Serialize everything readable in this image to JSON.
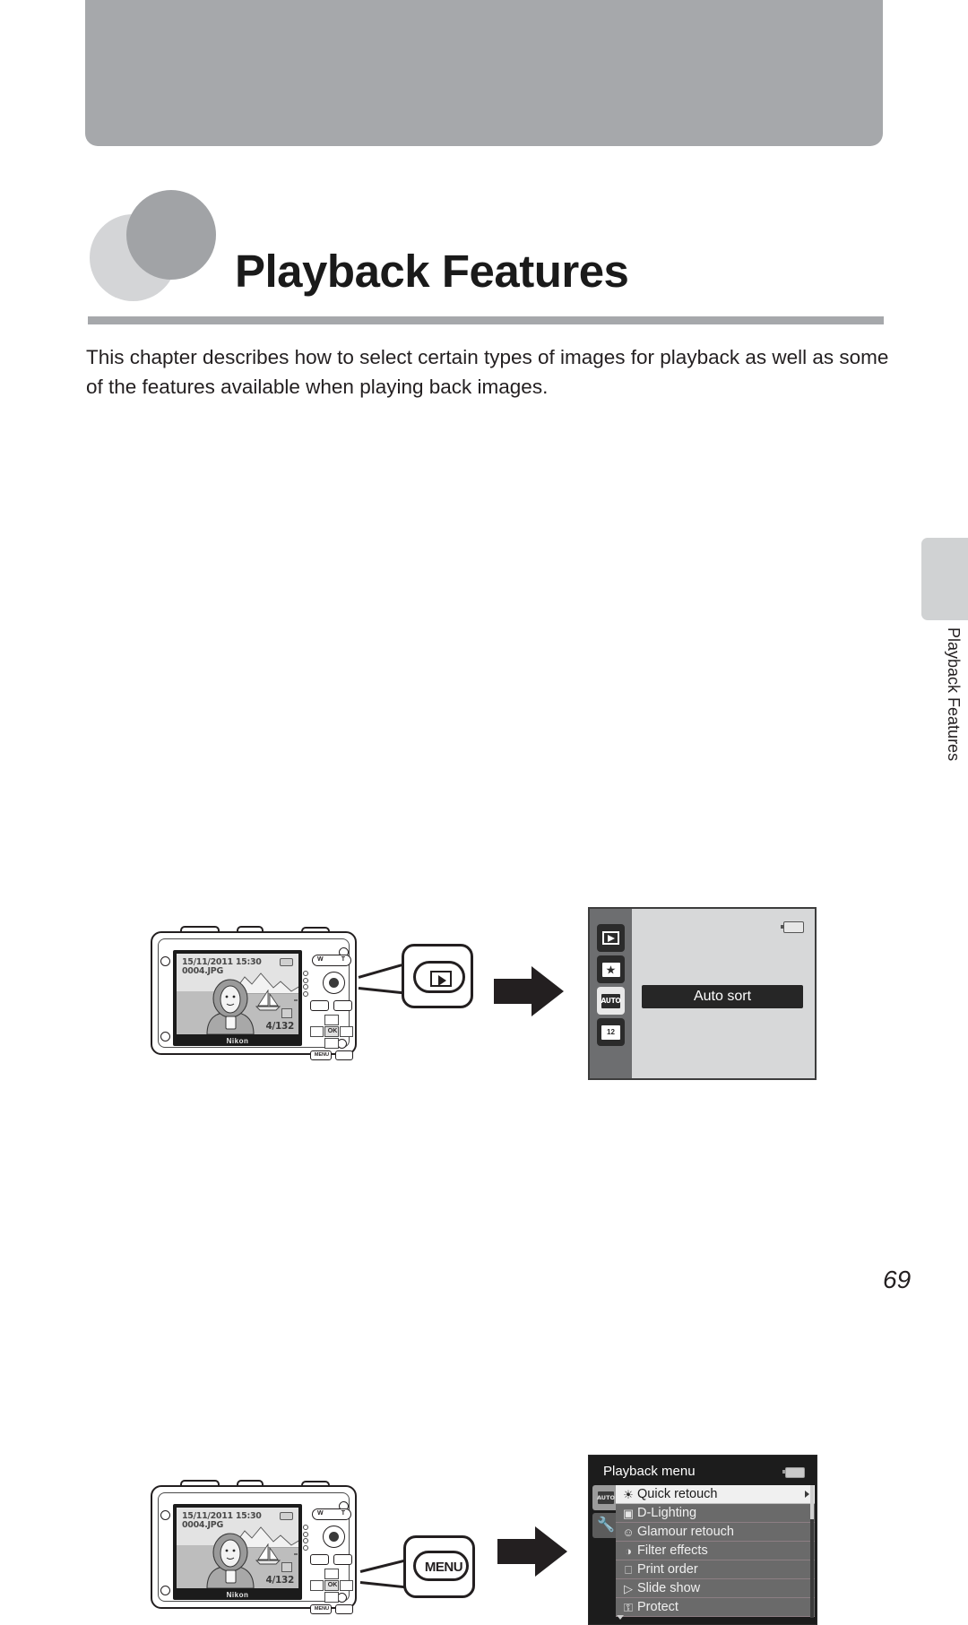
{
  "page": {
    "title": "Playback Features",
    "intro": "This chapter describes how to select certain types of images for playback as well as some of the features available when playing back images.",
    "side_tab_label": "Playback Features",
    "page_number": "69"
  },
  "camera": {
    "lcd": {
      "date": "15/11/2011",
      "time": "15:30",
      "filename": "0004.JPG",
      "counter": "4/132",
      "brand": "Nikon"
    },
    "controls": {
      "zoom_wide": "W",
      "zoom_tele": "T",
      "ok_label": "OK",
      "menu_label": "MENU"
    }
  },
  "steps": [
    {
      "callout_label": "",
      "callout_icon": "playback-button-icon"
    },
    {
      "callout_label": "MENU",
      "callout_icon": "menu-button-icon"
    }
  ],
  "auto_sort_screen": {
    "tooltip": "Auto sort",
    "sidebar": [
      {
        "icon": "playback-mode-icon",
        "label": "",
        "state": "dark"
      },
      {
        "icon": "favorite-pictures-folder-icon",
        "label": "",
        "state": "dark"
      },
      {
        "icon": "auto-sort-folder-icon",
        "label": "AUTO",
        "state": "active"
      },
      {
        "icon": "list-by-date-folder-icon",
        "label": "12",
        "state": "dark"
      }
    ],
    "battery_icon": "battery-icon"
  },
  "playback_menu_screen": {
    "title": "Playback menu",
    "battery_icon": "battery-icon",
    "sidebar": [
      {
        "icon": "auto-sort-folder-icon",
        "label": "AUTO"
      },
      {
        "icon": "setup-wrench-icon",
        "label": ""
      }
    ],
    "items": [
      {
        "label": "Quick retouch",
        "icon": "quick-retouch-icon",
        "selected": true,
        "has_submenu": true
      },
      {
        "label": "D-Lighting",
        "icon": "d-lighting-icon",
        "selected": false,
        "has_submenu": false
      },
      {
        "label": "Glamour retouch",
        "icon": "glamour-retouch-icon",
        "selected": false,
        "has_submenu": false
      },
      {
        "label": "Filter effects",
        "icon": "filter-effects-icon",
        "selected": false,
        "has_submenu": false
      },
      {
        "label": "Print order",
        "icon": "print-order-icon",
        "selected": false,
        "has_submenu": false
      },
      {
        "label": "Slide show",
        "icon": "slide-show-icon",
        "selected": false,
        "has_submenu": false
      },
      {
        "label": "Protect",
        "icon": "protect-key-icon",
        "selected": false,
        "has_submenu": false
      }
    ]
  },
  "colors": {
    "header_band": "#a6a8ab",
    "circle_light": "#d4d5d7",
    "circle_dark": "#a1a3a6",
    "rule": "#a6a8ab",
    "text": "#231f20",
    "menu_bg": "#1c1c1c",
    "menu_item": "#6a6a6a",
    "menu_selected": "#f0f0f0",
    "tooltip_bg": "#262626"
  }
}
